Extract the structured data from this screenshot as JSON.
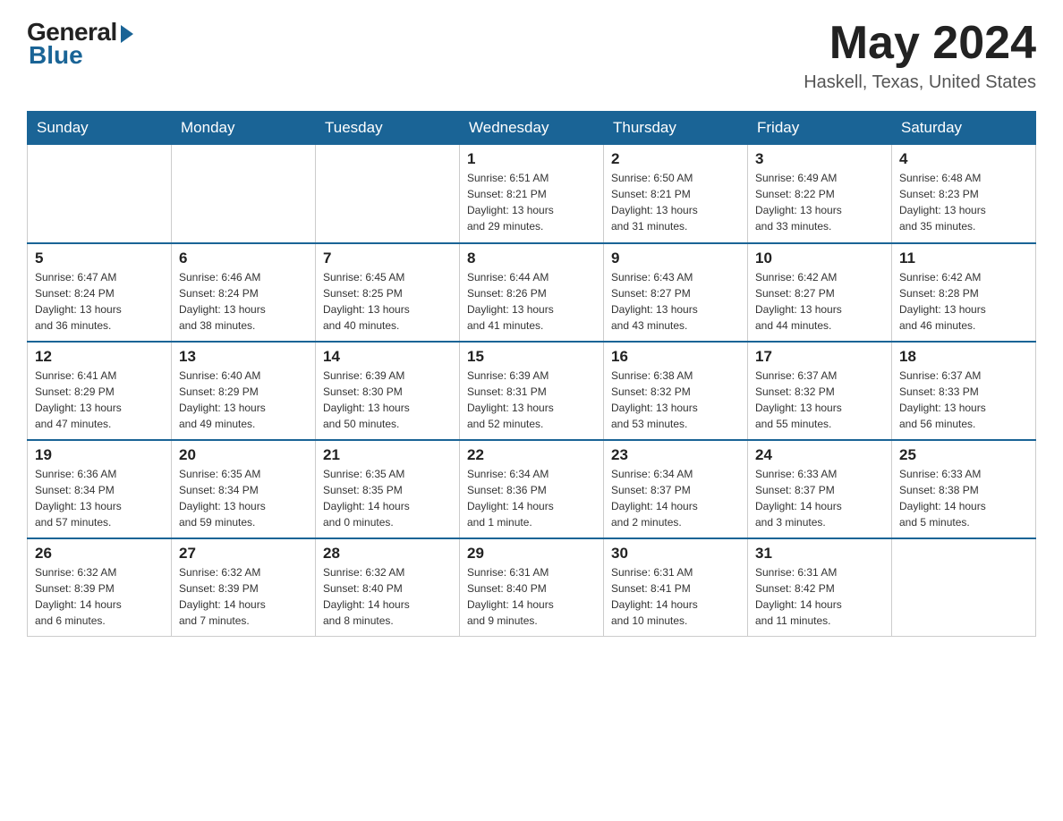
{
  "header": {
    "logo_general": "General",
    "logo_blue": "Blue",
    "month_year": "May 2024",
    "location": "Haskell, Texas, United States"
  },
  "days_of_week": [
    "Sunday",
    "Monday",
    "Tuesday",
    "Wednesday",
    "Thursday",
    "Friday",
    "Saturday"
  ],
  "weeks": [
    [
      {
        "day": "",
        "info": ""
      },
      {
        "day": "",
        "info": ""
      },
      {
        "day": "",
        "info": ""
      },
      {
        "day": "1",
        "info": "Sunrise: 6:51 AM\nSunset: 8:21 PM\nDaylight: 13 hours\nand 29 minutes."
      },
      {
        "day": "2",
        "info": "Sunrise: 6:50 AM\nSunset: 8:21 PM\nDaylight: 13 hours\nand 31 minutes."
      },
      {
        "day": "3",
        "info": "Sunrise: 6:49 AM\nSunset: 8:22 PM\nDaylight: 13 hours\nand 33 minutes."
      },
      {
        "day": "4",
        "info": "Sunrise: 6:48 AM\nSunset: 8:23 PM\nDaylight: 13 hours\nand 35 minutes."
      }
    ],
    [
      {
        "day": "5",
        "info": "Sunrise: 6:47 AM\nSunset: 8:24 PM\nDaylight: 13 hours\nand 36 minutes."
      },
      {
        "day": "6",
        "info": "Sunrise: 6:46 AM\nSunset: 8:24 PM\nDaylight: 13 hours\nand 38 minutes."
      },
      {
        "day": "7",
        "info": "Sunrise: 6:45 AM\nSunset: 8:25 PM\nDaylight: 13 hours\nand 40 minutes."
      },
      {
        "day": "8",
        "info": "Sunrise: 6:44 AM\nSunset: 8:26 PM\nDaylight: 13 hours\nand 41 minutes."
      },
      {
        "day": "9",
        "info": "Sunrise: 6:43 AM\nSunset: 8:27 PM\nDaylight: 13 hours\nand 43 minutes."
      },
      {
        "day": "10",
        "info": "Sunrise: 6:42 AM\nSunset: 8:27 PM\nDaylight: 13 hours\nand 44 minutes."
      },
      {
        "day": "11",
        "info": "Sunrise: 6:42 AM\nSunset: 8:28 PM\nDaylight: 13 hours\nand 46 minutes."
      }
    ],
    [
      {
        "day": "12",
        "info": "Sunrise: 6:41 AM\nSunset: 8:29 PM\nDaylight: 13 hours\nand 47 minutes."
      },
      {
        "day": "13",
        "info": "Sunrise: 6:40 AM\nSunset: 8:29 PM\nDaylight: 13 hours\nand 49 minutes."
      },
      {
        "day": "14",
        "info": "Sunrise: 6:39 AM\nSunset: 8:30 PM\nDaylight: 13 hours\nand 50 minutes."
      },
      {
        "day": "15",
        "info": "Sunrise: 6:39 AM\nSunset: 8:31 PM\nDaylight: 13 hours\nand 52 minutes."
      },
      {
        "day": "16",
        "info": "Sunrise: 6:38 AM\nSunset: 8:32 PM\nDaylight: 13 hours\nand 53 minutes."
      },
      {
        "day": "17",
        "info": "Sunrise: 6:37 AM\nSunset: 8:32 PM\nDaylight: 13 hours\nand 55 minutes."
      },
      {
        "day": "18",
        "info": "Sunrise: 6:37 AM\nSunset: 8:33 PM\nDaylight: 13 hours\nand 56 minutes."
      }
    ],
    [
      {
        "day": "19",
        "info": "Sunrise: 6:36 AM\nSunset: 8:34 PM\nDaylight: 13 hours\nand 57 minutes."
      },
      {
        "day": "20",
        "info": "Sunrise: 6:35 AM\nSunset: 8:34 PM\nDaylight: 13 hours\nand 59 minutes."
      },
      {
        "day": "21",
        "info": "Sunrise: 6:35 AM\nSunset: 8:35 PM\nDaylight: 14 hours\nand 0 minutes."
      },
      {
        "day": "22",
        "info": "Sunrise: 6:34 AM\nSunset: 8:36 PM\nDaylight: 14 hours\nand 1 minute."
      },
      {
        "day": "23",
        "info": "Sunrise: 6:34 AM\nSunset: 8:37 PM\nDaylight: 14 hours\nand 2 minutes."
      },
      {
        "day": "24",
        "info": "Sunrise: 6:33 AM\nSunset: 8:37 PM\nDaylight: 14 hours\nand 3 minutes."
      },
      {
        "day": "25",
        "info": "Sunrise: 6:33 AM\nSunset: 8:38 PM\nDaylight: 14 hours\nand 5 minutes."
      }
    ],
    [
      {
        "day": "26",
        "info": "Sunrise: 6:32 AM\nSunset: 8:39 PM\nDaylight: 14 hours\nand 6 minutes."
      },
      {
        "day": "27",
        "info": "Sunrise: 6:32 AM\nSunset: 8:39 PM\nDaylight: 14 hours\nand 7 minutes."
      },
      {
        "day": "28",
        "info": "Sunrise: 6:32 AM\nSunset: 8:40 PM\nDaylight: 14 hours\nand 8 minutes."
      },
      {
        "day": "29",
        "info": "Sunrise: 6:31 AM\nSunset: 8:40 PM\nDaylight: 14 hours\nand 9 minutes."
      },
      {
        "day": "30",
        "info": "Sunrise: 6:31 AM\nSunset: 8:41 PM\nDaylight: 14 hours\nand 10 minutes."
      },
      {
        "day": "31",
        "info": "Sunrise: 6:31 AM\nSunset: 8:42 PM\nDaylight: 14 hours\nand 11 minutes."
      },
      {
        "day": "",
        "info": ""
      }
    ]
  ]
}
